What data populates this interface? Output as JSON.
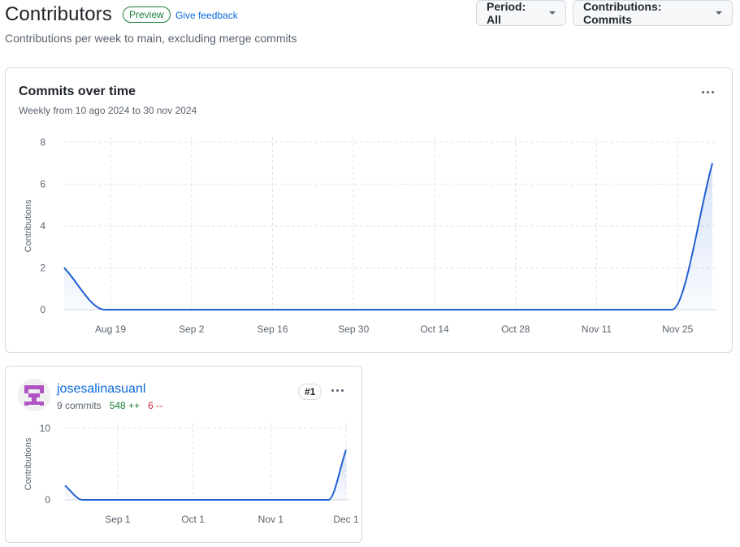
{
  "header": {
    "title": "Contributors",
    "badge": "Preview",
    "feedback": "Give feedback",
    "subtitle": "Contributions per week to main, excluding merge commits"
  },
  "controls": {
    "period_label": "Period: All",
    "contrib_label": "Contributions: Commits"
  },
  "main_chart": {
    "title": "Commits over time",
    "subtitle": "Weekly from 10 ago 2024 to 30 nov 2024"
  },
  "contributor": {
    "name": "josesalinasuanl",
    "commits": "9 commits",
    "additions": "548 ++",
    "deletions": "6 --",
    "rank": "#1",
    "avatar_color": "#b053c4"
  },
  "chart_data": [
    {
      "type": "area",
      "title": "Commits over time",
      "ylabel": "Contributions",
      "xlabel": "",
      "ylim": [
        0,
        8
      ],
      "yticks": [
        "0",
        "2",
        "4",
        "6",
        "8"
      ],
      "xticks": [
        "Aug 19",
        "Sep 2",
        "Sep 16",
        "Sep 30",
        "Oct 14",
        "Oct 28",
        "Nov 11",
        "Nov 25"
      ],
      "x": [
        "2024-08-11",
        "2024-08-18",
        "2024-08-25",
        "2024-09-01",
        "2024-09-08",
        "2024-09-15",
        "2024-09-22",
        "2024-09-29",
        "2024-10-06",
        "2024-10-13",
        "2024-10-20",
        "2024-10-27",
        "2024-11-03",
        "2024-11-10",
        "2024-11-17",
        "2024-11-24",
        "2024-12-01"
      ],
      "values": [
        2,
        0,
        0,
        0,
        0,
        0,
        0,
        0,
        0,
        0,
        0,
        0,
        0,
        0,
        0,
        0,
        7
      ],
      "grid": true,
      "color": "#2260d1"
    },
    {
      "type": "area",
      "title": "",
      "ylabel": "Contributions",
      "xlabel": "",
      "ylim": [
        0,
        10
      ],
      "yticks": [
        "0",
        "10"
      ],
      "xticks": [
        "Sep 1",
        "Oct 1",
        "Nov 1",
        "Dec 1"
      ],
      "x": [
        "2024-08-11",
        "2024-08-18",
        "2024-08-25",
        "2024-09-01",
        "2024-09-08",
        "2024-09-15",
        "2024-09-22",
        "2024-09-29",
        "2024-10-06",
        "2024-10-13",
        "2024-10-20",
        "2024-10-27",
        "2024-11-03",
        "2024-11-10",
        "2024-11-17",
        "2024-11-24",
        "2024-12-01"
      ],
      "values": [
        2,
        0,
        0,
        0,
        0,
        0,
        0,
        0,
        0,
        0,
        0,
        0,
        0,
        0,
        0,
        0,
        7
      ],
      "grid": true,
      "color": "#2260d1"
    }
  ]
}
